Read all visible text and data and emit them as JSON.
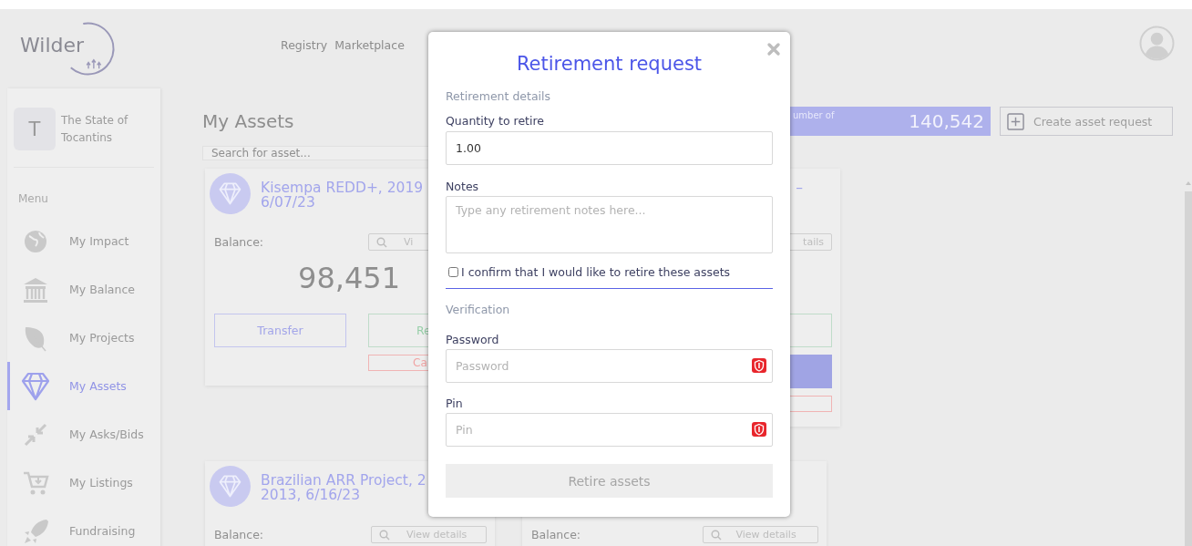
{
  "header": {
    "logo": "Wilder",
    "nav": [
      "Registry",
      "Marketplace"
    ]
  },
  "sidebar": {
    "profile": {
      "initial": "T",
      "name": "The State of Tocantins"
    },
    "menu_title": "Menu",
    "items": [
      {
        "label": "My Impact",
        "selected": false
      },
      {
        "label": "My Balance",
        "selected": false
      },
      {
        "label": "My Projects",
        "selected": false
      },
      {
        "label": "My Assets",
        "selected": true
      },
      {
        "label": "My Asks/Bids",
        "selected": false
      },
      {
        "label": "My Listings",
        "selected": false
      },
      {
        "label": "Fundraising",
        "selected": false
      }
    ]
  },
  "page": {
    "title": "My Assets",
    "search_placeholder": "Search for asset...",
    "total": {
      "label": "umber of",
      "value": "140,542"
    },
    "create_button": "Create asset request"
  },
  "cards": [
    {
      "kind": "cut-right",
      "title_lines": [
        "Kisempa REDD+, 2019",
        "6/07/23"
      ],
      "balance_label": "Balance:",
      "view_label": "Vi",
      "amount": "98,451",
      "buttons": [
        {
          "label": "Transfer",
          "kind": "outline"
        },
        {
          "label": "Re",
          "kind": "success"
        },
        {
          "label": "Ca",
          "kind": "danger"
        }
      ]
    },
    {
      "kind": "cut-left",
      "title_lines": [
        "–"
      ],
      "view_label": "tails",
      "buttons": [
        {
          "kind": "success"
        },
        {
          "kind": "primary"
        },
        {
          "kind": "danger"
        }
      ]
    },
    {
      "kind": "cut-right",
      "title_lines": [
        "Brazilian ARR Project, 2",
        "2013, 6/16/23"
      ],
      "balance_label": "Balance:",
      "view_label": "View details"
    },
    {
      "kind": "whole",
      "balance_label": "Balance:",
      "view_label": "View details"
    }
  ],
  "modal": {
    "title": "Retirement request",
    "details_heading": "Retirement details",
    "quantity": {
      "label": "Quantity to retire",
      "value": "1.00"
    },
    "notes": {
      "label": "Notes",
      "placeholder": "Type any retirement notes here..."
    },
    "confirm": {
      "label": "I confirm that I would like to retire these assets",
      "checked": false
    },
    "verification_heading": "Verification",
    "password": {
      "label": "Password",
      "placeholder": "Password"
    },
    "pin": {
      "label": "Pin",
      "placeholder": "Pin"
    },
    "submit": {
      "label": "Retire assets",
      "disabled": true
    }
  }
}
